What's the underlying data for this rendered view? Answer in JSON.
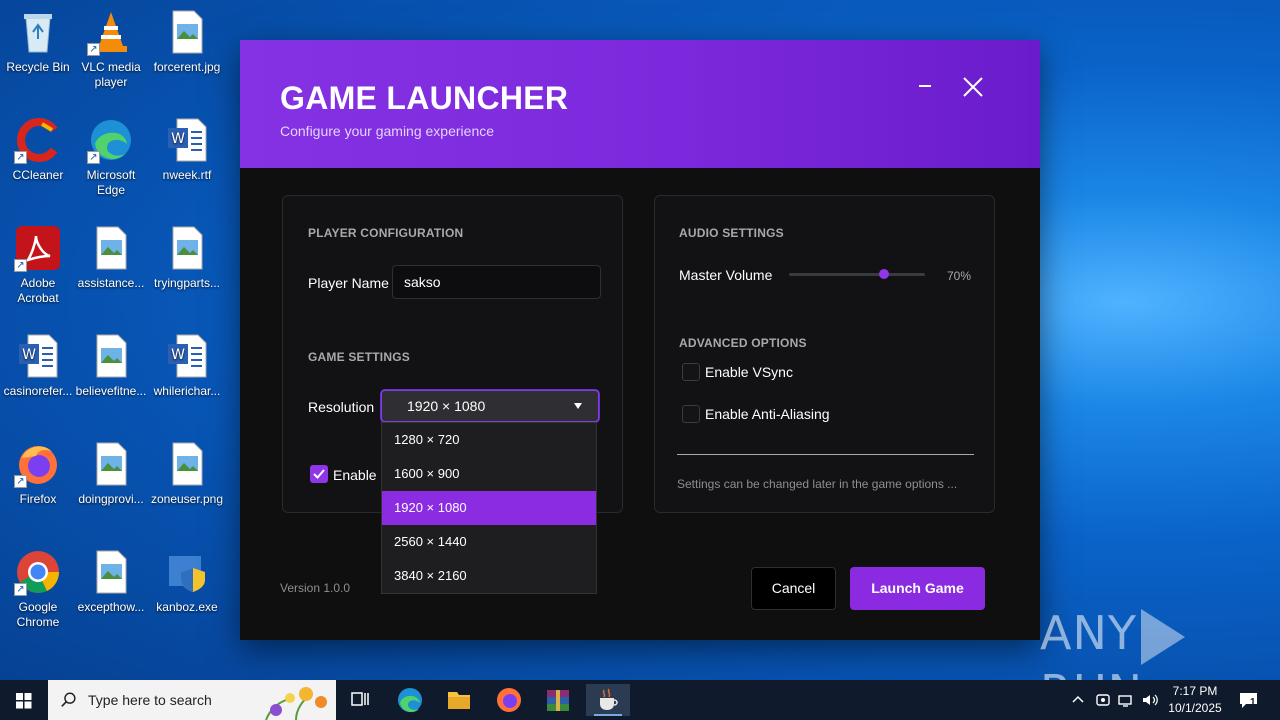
{
  "desktop": {
    "icons": [
      {
        "label": "Recycle Bin"
      },
      {
        "label": "VLC media player"
      },
      {
        "label": "forcerent.jpg"
      },
      {
        "label": "CCleaner"
      },
      {
        "label": "Microsoft Edge"
      },
      {
        "label": "nweek.rtf"
      },
      {
        "label": "Adobe Acrobat"
      },
      {
        "label": "assistance..."
      },
      {
        "label": "tryingparts..."
      },
      {
        "label": "casinorefer..."
      },
      {
        "label": "believefitne..."
      },
      {
        "label": "whilerichar..."
      },
      {
        "label": "Firefox"
      },
      {
        "label": "doingprovi..."
      },
      {
        "label": "zoneuser.png"
      },
      {
        "label": "Google Chrome"
      },
      {
        "label": "excepthow..."
      },
      {
        "label": "kanboz.exe"
      }
    ]
  },
  "launcher": {
    "title": "GAME LAUNCHER",
    "subtitle": "Configure your gaming experience",
    "player_section": "PLAYER CONFIGURATION",
    "player_name_label": "Player Name",
    "player_name_value": "sakso",
    "game_section": "GAME SETTINGS",
    "resolution_label": "Resolution",
    "resolution_value": "1920 × 1080",
    "resolution_options": [
      "1280 × 720",
      "1600 × 900",
      "1920 × 1080",
      "2560 × 1440",
      "3840 × 2160"
    ],
    "enable_label": "Enable",
    "audio_section": "AUDIO SETTINGS",
    "volume_label": "Master Volume",
    "volume_value": "70%",
    "volume_fraction": 0.7,
    "advanced_section": "ADVANCED OPTIONS",
    "vsync_label": "Enable VSync",
    "aa_label": "Enable Anti-Aliasing",
    "hint": "Settings can be changed later in the game options ...",
    "version": "Version 1.0.0",
    "cancel_label": "Cancel",
    "launch_label": "Launch Game",
    "accent_color": "#8a2be2"
  },
  "watermark": {
    "left": "ANY",
    "right": "RUN"
  },
  "taskbar": {
    "search_placeholder": "Type here to search",
    "time": "7:17 PM",
    "date": "10/1/2025",
    "notification_count": "1"
  }
}
